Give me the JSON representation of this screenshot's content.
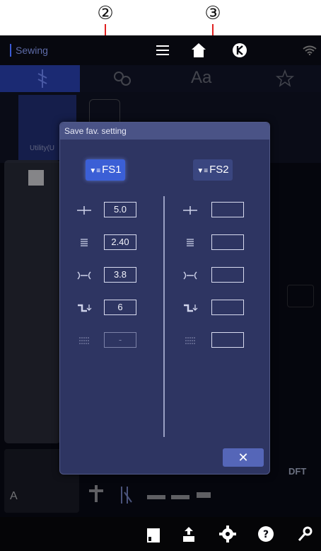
{
  "callouts": [
    {
      "label": "②"
    },
    {
      "label": "③"
    }
  ],
  "app": {
    "title": "Sewing"
  },
  "background": {
    "stitch_label": "Utility(U",
    "dft_label": "DFT",
    "foot_letter": "A"
  },
  "dialog": {
    "title": "Save fav. setting",
    "fs1_label": "FS1",
    "fs2_label": "FS2",
    "fs1_values": {
      "stitch_width": "5.0",
      "stitch_length": "2.40",
      "tension": "3.8",
      "presser_foot_pressure": "6",
      "dual_feed": "-"
    },
    "fs2_values": {
      "stitch_width": "",
      "stitch_length": "",
      "tension": "",
      "presser_foot_pressure": "",
      "dual_feed": ""
    },
    "close_label": "✕"
  },
  "colors": {
    "accent": "#3b5fd6",
    "dialog_bg": "#2e3562",
    "callout_line": "#e02020"
  }
}
